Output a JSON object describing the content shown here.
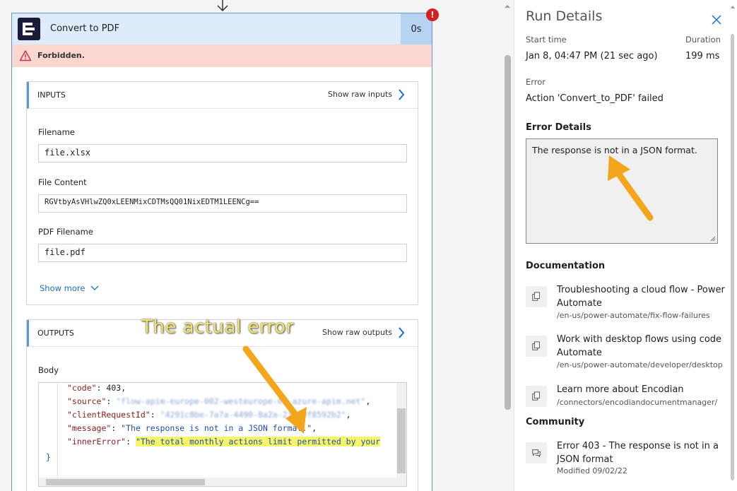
{
  "card": {
    "title": "Convert to PDF",
    "duration": "0s",
    "error_badge": "!",
    "status_message": "Forbidden."
  },
  "inputs": {
    "title": "INPUTS",
    "show_raw": "Show raw inputs",
    "fields": [
      {
        "label": "Filename",
        "value": "file.xlsx"
      },
      {
        "label": "File Content",
        "value": "RGVtbyAsVHlwZQ0xLEENMixCDTMsQQ01NixEDTM1LEENCg=="
      },
      {
        "label": "PDF Filename",
        "value": "file.pdf"
      }
    ],
    "show_more": "Show more"
  },
  "outputs": {
    "title": "OUTPUTS",
    "show_raw": "Show raw outputs",
    "body_label": "Body",
    "code": {
      "code_key": "\"code\"",
      "code_val": "403",
      "source_key": "\"source\"",
      "source_val": "\"flow-apim-europe-002-westeurope-01.azure-apim.net\"",
      "client_key": "\"clientRequestId\"",
      "client_val": "\"4291c8be-7a7a-4490-8a2a-232f9f8592b2\"",
      "message_key": "\"message\"",
      "message_val": "\"The response is not in a JSON format.\"",
      "inner_key": "\"innerError\"",
      "inner_val": "\"The total monthly actions limit permitted by your",
      "close_brace": "}"
    }
  },
  "annotation": {
    "text": "The actual error"
  },
  "run_details": {
    "title": "Run Details",
    "start_time_label": "Start time",
    "start_time_value": "Jan 8, 04:47 PM (21 sec ago)",
    "duration_label": "Duration",
    "duration_value": "199 ms",
    "error_label": "Error",
    "error_value": "Action 'Convert_to_PDF' failed",
    "error_details_label": "Error Details",
    "error_details_value": "The response is not in a JSON format.",
    "documentation_label": "Documentation",
    "docs": [
      {
        "title": "Troubleshooting a cloud flow - Power Automate",
        "path": "/en-us/power-automate/fix-flow-failures"
      },
      {
        "title": "Work with desktop flows using code Automate",
        "path": "/en-us/power-automate/developer/desktop"
      },
      {
        "title": "Learn more about Encodian",
        "path": "/connectors/encodiandocumentmanager/"
      }
    ],
    "community_label": "Community",
    "community": [
      {
        "title": "Error 403 - The response is not in a JSON format",
        "modified": "Modified 09/02/22"
      }
    ]
  },
  "colors": {
    "accent": "#5f97d6",
    "error_bar": "#fbd7cf",
    "header": "#ddebfa",
    "highlight": "#f6f56a",
    "annotation": "#f3a51c"
  }
}
